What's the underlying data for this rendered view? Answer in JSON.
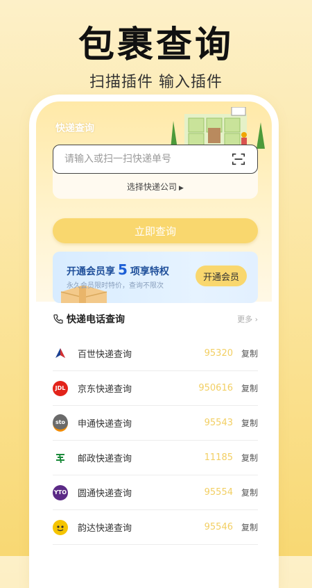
{
  "hero": {
    "title": "包裹查询",
    "subtitle": "扫描插件 输入插件"
  },
  "app": {
    "title": "快递查询",
    "search": {
      "placeholder": "请输入或扫一扫快递单号",
      "value": ""
    },
    "company_select_label": "选择快递公司",
    "query_button_label": "立即查询",
    "vip": {
      "title_prefix": "开通会员享",
      "title_number": "5",
      "title_suffix": "项享特权",
      "description": "永久会员限时特价，查询不限次",
      "button_label": "开通会员"
    },
    "section": {
      "title": "快递电话查询",
      "more_label": "更多"
    },
    "couriers": [
      {
        "name": "百世快递查询",
        "number": "95320",
        "copy_label": "复制",
        "logo_icon": "best-express-logo",
        "logo_text": "",
        "logo_color": "#ffffff"
      },
      {
        "name": "京东快递查询",
        "number": "950616",
        "copy_label": "复制",
        "logo_icon": "jd-logistics-logo",
        "logo_text": "JDL",
        "logo_color": "#e2231a"
      },
      {
        "name": "申通快递查询",
        "number": "95543",
        "copy_label": "复制",
        "logo_icon": "sto-express-logo",
        "logo_text": "sto",
        "logo_color": "#666666"
      },
      {
        "name": "邮政快递查询",
        "number": "11185",
        "copy_label": "复制",
        "logo_icon": "china-post-logo",
        "logo_text": "",
        "logo_color": "#ffffff"
      },
      {
        "name": "圆通快递查询",
        "number": "95554",
        "copy_label": "复制",
        "logo_icon": "yto-express-logo",
        "logo_text": "YTO",
        "logo_color": "#5b2a86"
      },
      {
        "name": "韵达快递查询",
        "number": "95546",
        "copy_label": "复制",
        "logo_icon": "yunda-express-logo",
        "logo_text": "",
        "logo_color": "#f5c400"
      }
    ]
  },
  "colors": {
    "accent_yellow": "#f9d76e",
    "number_yellow": "#f2cf63",
    "vip_blue": "#1c5fd6"
  }
}
